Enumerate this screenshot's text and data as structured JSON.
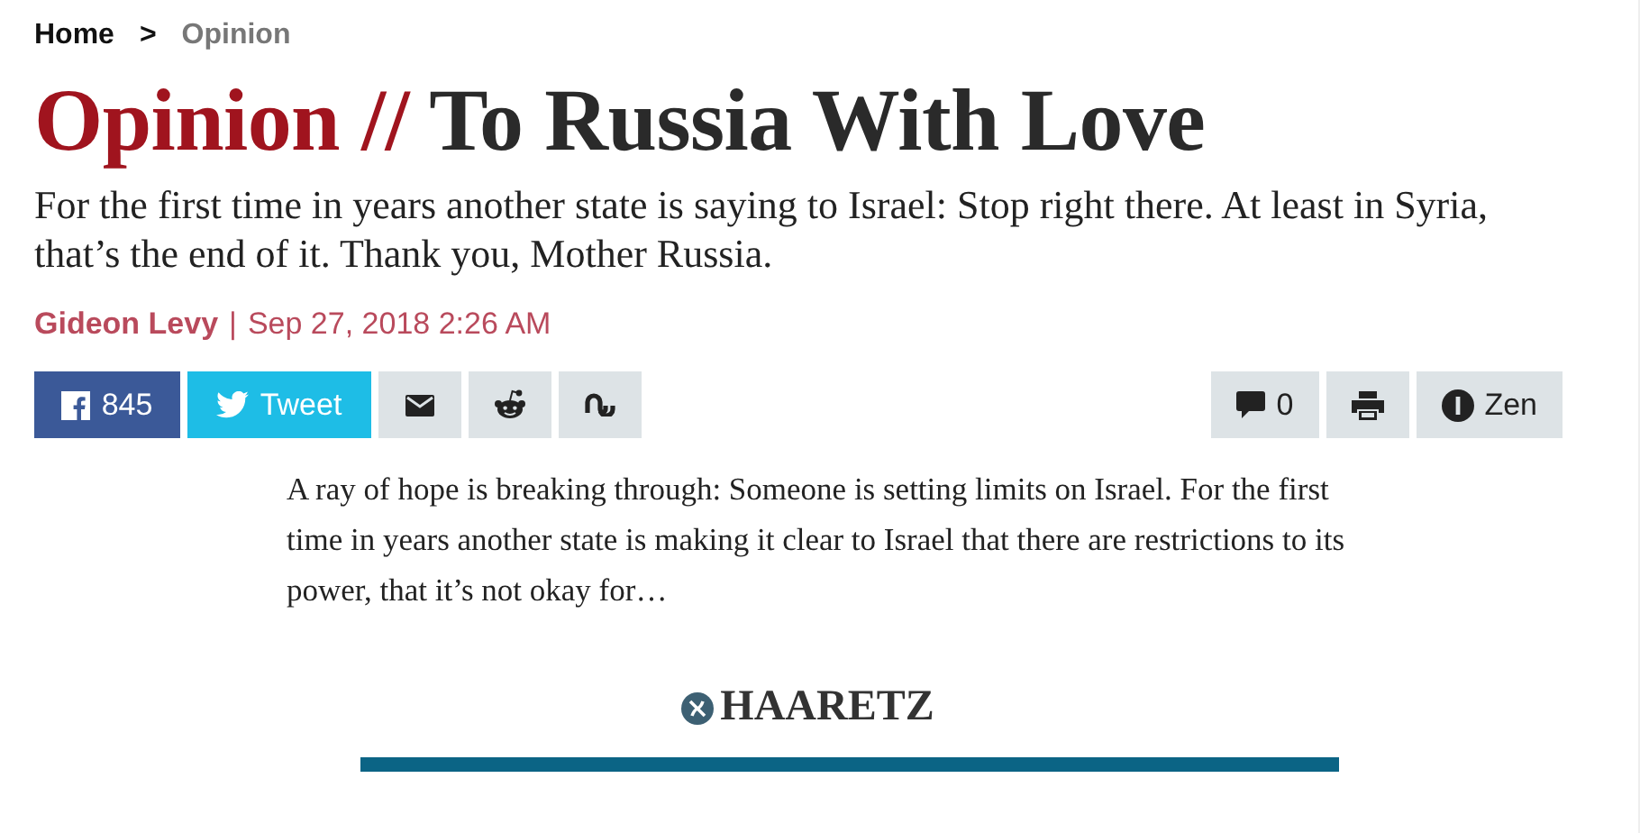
{
  "breadcrumb": [
    {
      "label": "Home",
      "selected": false
    },
    {
      "label": "Opinion",
      "selected": true
    }
  ],
  "breadcrumb_separator": ">",
  "headline": {
    "section": "Opinion",
    "separator": "//",
    "title": "To Russia With Love"
  },
  "subtitle": "For the first time in years another state is saying to Israel: Stop right there. At least in Syria, that’s the end of it. Thank you, Mother Russia.",
  "byline": {
    "author": "Gideon Levy",
    "separator": "|",
    "date": "Sep 27, 2018 2:26 AM"
  },
  "share_buttons": [
    {
      "kind": "facebook",
      "label": "845"
    },
    {
      "kind": "twitter",
      "label": "Tweet"
    },
    {
      "kind": "email"
    },
    {
      "kind": "reddit"
    },
    {
      "kind": "stumbleupon"
    }
  ],
  "tool_buttons": [
    {
      "kind": "comments",
      "label": "0"
    },
    {
      "kind": "print"
    },
    {
      "kind": "zen",
      "label": "Zen"
    }
  ],
  "excerpt": "A ray of hope is breaking through: Someone is setting limits on Israel. For the first time in years another state is making it clear to Israel that there are restrictions to its power, that it’s not okay for…",
  "logo": "HAARETZ"
}
